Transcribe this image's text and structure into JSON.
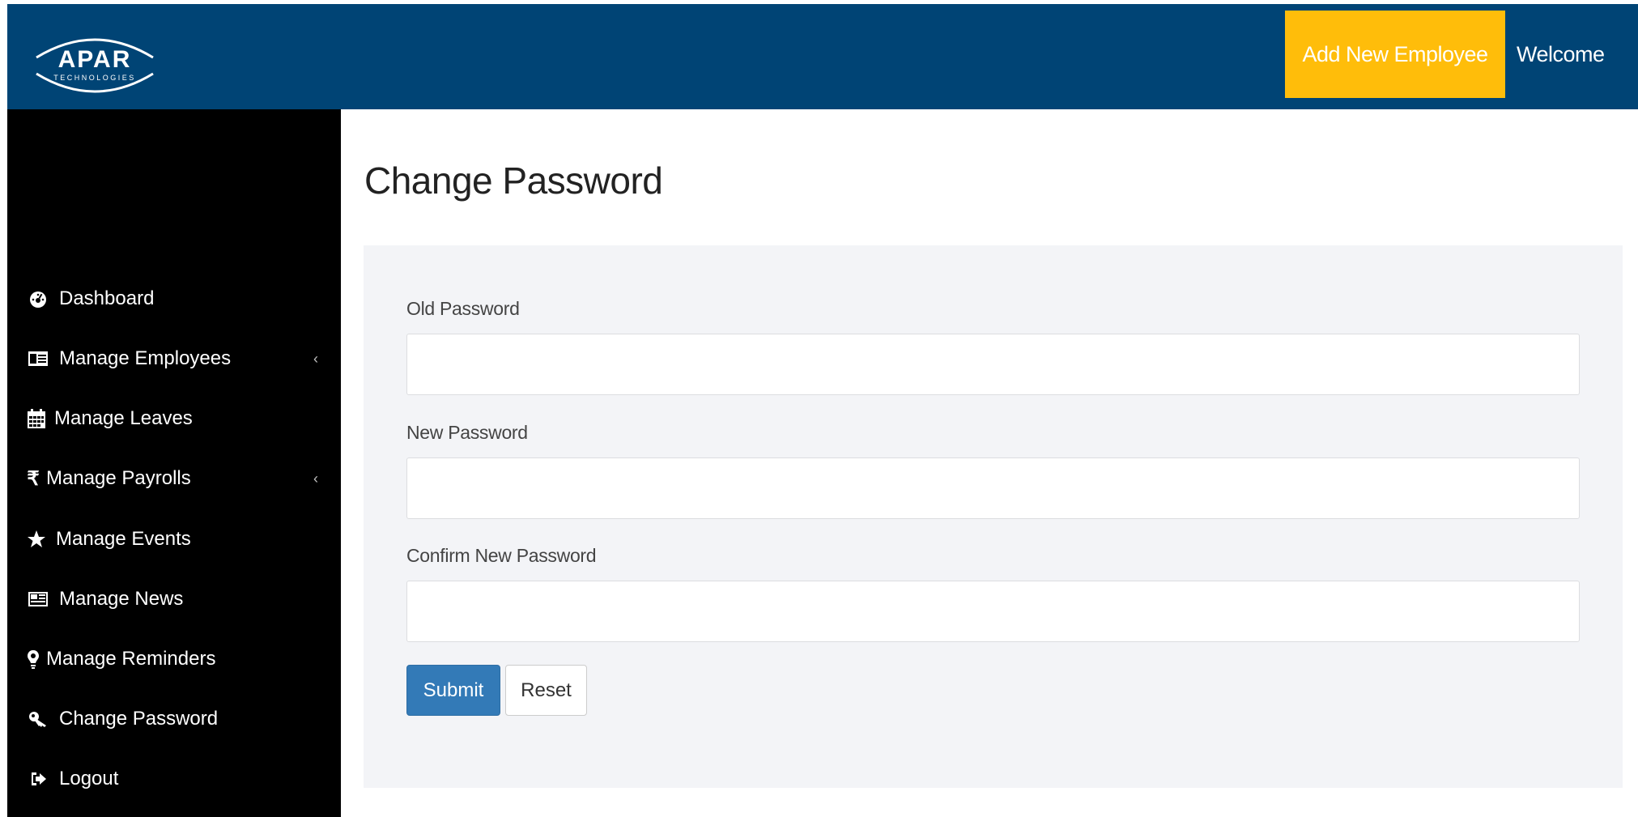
{
  "header": {
    "logo_text": "APAR",
    "logo_subtext": "TECHNOLOGIES",
    "add_employee_label": "Add New Employee",
    "welcome_label": "Welcome"
  },
  "sidebar": {
    "items": [
      {
        "label": "Dashboard",
        "icon": "dashboard-icon"
      },
      {
        "label": "Manage Employees",
        "icon": "id-card-icon",
        "chevron": "‹"
      },
      {
        "label": "Manage Leaves",
        "icon": "calendar-icon"
      },
      {
        "label": "Manage Payrolls",
        "icon": "rupee-icon",
        "chevron": "‹"
      },
      {
        "label": "Manage Events",
        "icon": "star-icon"
      },
      {
        "label": "Manage News",
        "icon": "newspaper-icon"
      },
      {
        "label": "Manage Reminders",
        "icon": "lightbulb-icon"
      },
      {
        "label": "Change Password",
        "icon": "key-icon"
      },
      {
        "label": "Logout",
        "icon": "sign-out-icon"
      }
    ]
  },
  "main": {
    "title": "Change Password",
    "form": {
      "old_password_label": "Old Password",
      "old_password_value": "",
      "new_password_label": "New Password",
      "new_password_value": "",
      "confirm_password_label": "Confirm New Password",
      "confirm_password_value": "",
      "submit_label": "Submit",
      "reset_label": "Reset"
    }
  },
  "colors": {
    "header_bg": "#004475",
    "accent_yellow": "#ffbd0a",
    "sidebar_bg": "#000000",
    "submit_blue": "#337ab7"
  }
}
